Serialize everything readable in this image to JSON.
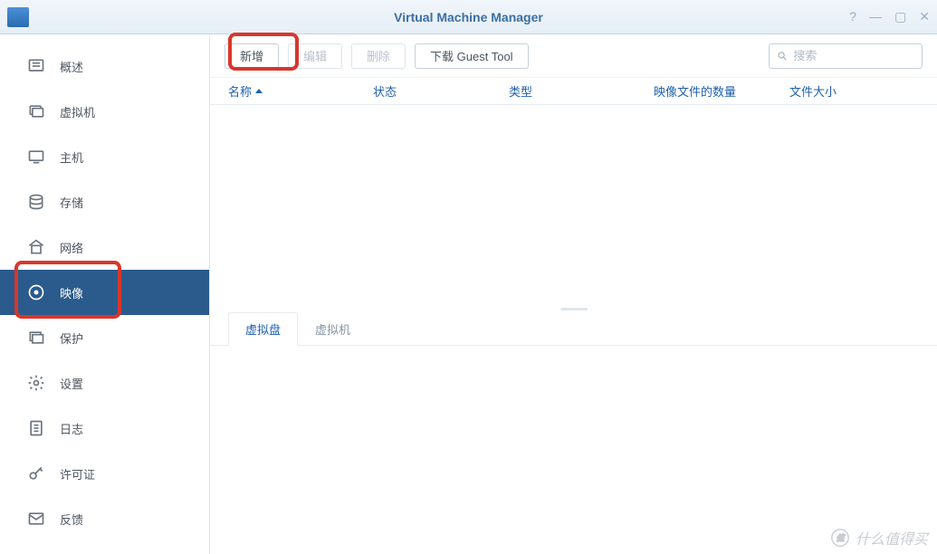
{
  "app": {
    "title": "Virtual Machine Manager"
  },
  "window_controls": {
    "help": "?",
    "minimize": "—",
    "maximize": "▢",
    "close": "✕"
  },
  "sidebar": {
    "items": [
      {
        "label": "概述"
      },
      {
        "label": "虚拟机"
      },
      {
        "label": "主机"
      },
      {
        "label": "存储"
      },
      {
        "label": "网络"
      },
      {
        "label": "映像"
      },
      {
        "label": "保护"
      },
      {
        "label": "设置"
      },
      {
        "label": "日志"
      },
      {
        "label": "许可证"
      },
      {
        "label": "反馈"
      }
    ],
    "active_index": 5
  },
  "toolbar": {
    "add": "新增",
    "edit": "编辑",
    "delete": "删除",
    "download_guest_tool": "下载 Guest Tool"
  },
  "search": {
    "placeholder": "搜索"
  },
  "table": {
    "columns": {
      "name": "名称",
      "status": "状态",
      "type": "类型",
      "image_count": "映像文件的数量",
      "file_size": "文件大小"
    },
    "sort_column": "name",
    "sort_dir": "asc",
    "rows": []
  },
  "sub_tabs": {
    "items": [
      {
        "label": "虚拟盘"
      },
      {
        "label": "虚拟机"
      }
    ],
    "active_index": 0
  },
  "watermark": "什么值得买"
}
